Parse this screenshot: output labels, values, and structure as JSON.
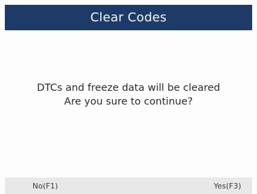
{
  "header": {
    "title": "Clear Codes"
  },
  "dialog": {
    "message_line1": "DTCs and freeze data will be cleared",
    "message_line2": "Are you sure to continue?"
  },
  "footer": {
    "no_label": "No(F1)",
    "yes_label": "Yes(F3)"
  },
  "colors": {
    "title_bar": "#1e3a68",
    "footer_bar": "#e8e8e8"
  }
}
